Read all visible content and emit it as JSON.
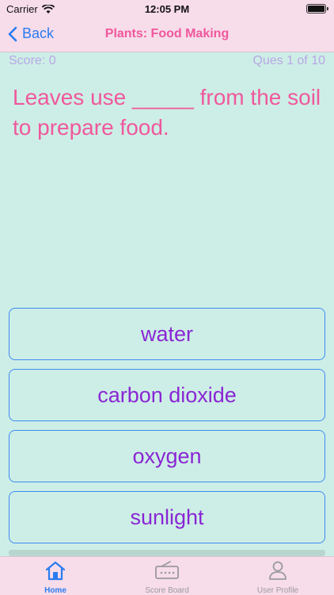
{
  "status": {
    "carrier": "Carrier",
    "time": "12:05 PM"
  },
  "nav": {
    "back_label": "Back",
    "title": "Plants: Food Making"
  },
  "quiz": {
    "score": "Score: 0",
    "progress": "Ques 1 of 10",
    "question": "Leaves use _____ from the soil to prepare food.",
    "options": [
      "water",
      "carbon dioxide",
      "oxygen",
      "sunlight"
    ]
  },
  "tabs": [
    {
      "label": "Home",
      "icon": "home-icon",
      "active": true
    },
    {
      "label": "Score Board",
      "icon": "scoreboard-icon",
      "active": false
    },
    {
      "label": "User Profile",
      "icon": "user-icon",
      "active": false
    }
  ],
  "colors": {
    "background": "#cdeee6",
    "bar": "#f7dcea",
    "title": "#f0589c",
    "answer_text": "#8a26d4",
    "answer_border": "#3d8cf5",
    "accent": "#2a7cf0"
  }
}
